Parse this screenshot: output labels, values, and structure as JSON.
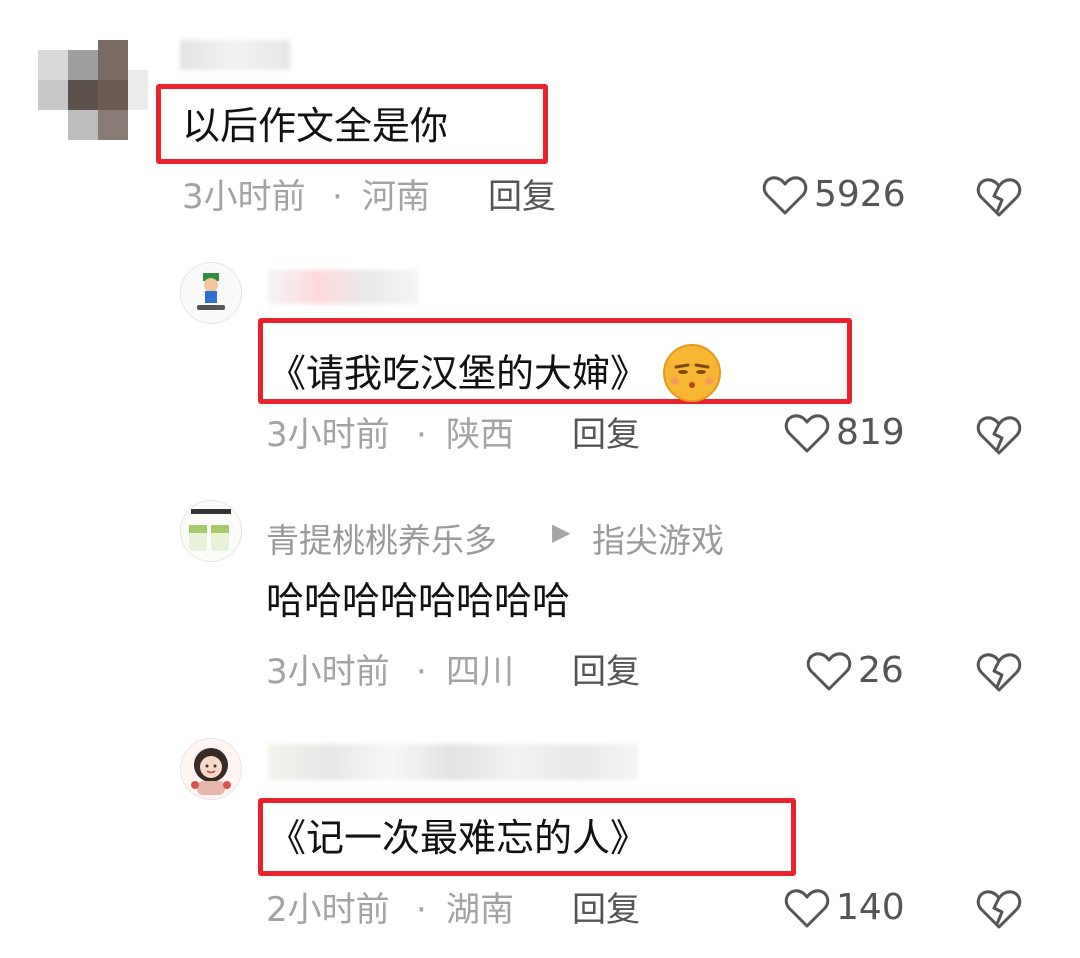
{
  "comments": [
    {
      "username": "",
      "text": "以后作文全是你",
      "time": "3小时前",
      "location": "河南",
      "reply_label": "回复",
      "likes": "5926",
      "highlighted": true
    },
    {
      "username": "",
      "text": "《请我吃汉堡的大婶》",
      "time": "3小时前",
      "location": "陕西",
      "reply_label": "回复",
      "likes": "819",
      "highlighted": true
    },
    {
      "username": "青提桃桃养乐多",
      "reply_to": "指尖游戏",
      "text": "哈哈哈哈哈哈哈哈",
      "time": "3小时前",
      "location": "四川",
      "reply_label": "回复",
      "likes": "26",
      "highlighted": false
    },
    {
      "username": "",
      "text": "《记一次最难忘的人》",
      "time": "2小时前",
      "location": "湖南",
      "reply_label": "回复",
      "likes": "140",
      "highlighted": true
    }
  ],
  "meta_separator": "·",
  "colors": {
    "highlight": "#e8232e",
    "meta": "#a3a3a3"
  }
}
